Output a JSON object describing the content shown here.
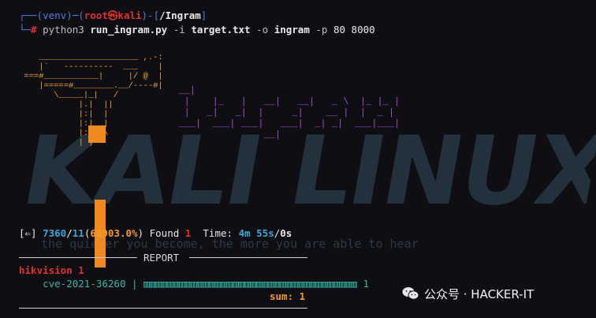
{
  "prompt": {
    "venv": "(venv)",
    "user": "root",
    "host": "kali",
    "path": "/Ingram",
    "symbol": "#",
    "command": {
      "program": "python3",
      "script": "run_ingram.py",
      "flag_i": "-i",
      "input_file": "target.txt",
      "flag_o": "-o",
      "output_dir": "ingram",
      "flag_p": "-p",
      "ports": "80 8000"
    }
  },
  "watermark": {
    "title": "KALI LINUX",
    "tagline": "the quieter you become, the more you are able to hear"
  },
  "progress": {
    "icon": "[⇐]",
    "scanned": "7360",
    "total": "11",
    "percent": "66903.0%",
    "found_label": "Found",
    "found": "1",
    "time_label": "Time:",
    "elapsed": "4m 55s",
    "remaining": "0s"
  },
  "report": {
    "title": "REPORT",
    "vendor": "hikvision 1",
    "cve": "cve-2021-36260",
    "cve_count": "1",
    "sum_label": "sum:",
    "sum_value": "1"
  },
  "brand": {
    "text": "公众号 · HACKER-IT"
  },
  "colors": {
    "background": "#0f0f13",
    "prompt_blue": "#4d7bd6",
    "root_red": "#e0302f",
    "hammer_orange": "#f08a1e",
    "ingram_purple": "#9a4dd2",
    "accent_cyan": "#38a7d6",
    "bar_teal": "#37b6a8"
  }
}
